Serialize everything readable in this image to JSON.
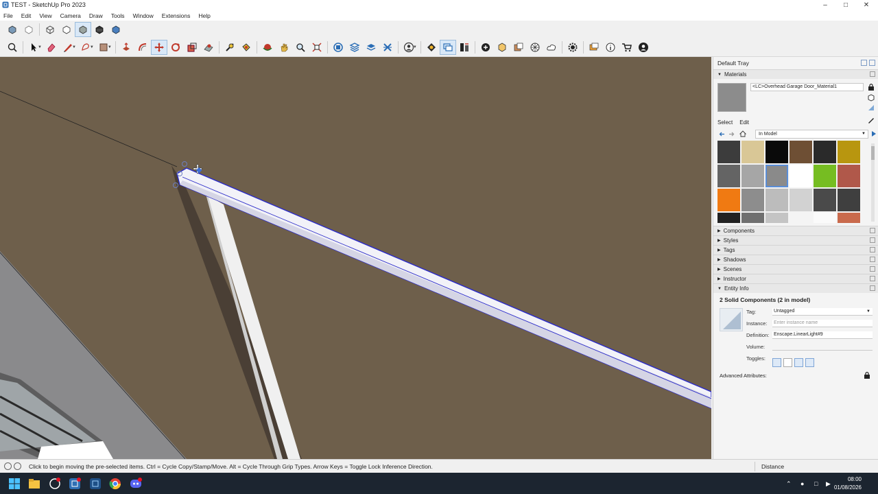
{
  "window": {
    "title": "TEST - SketchUp Pro 2023"
  },
  "menu": [
    "File",
    "Edit",
    "View",
    "Camera",
    "Draw",
    "Tools",
    "Window",
    "Extensions",
    "Help"
  ],
  "tray": {
    "title": "Default Tray",
    "materials": {
      "panel_label": "Materials",
      "current_name": "<LC>Overhead Garage Door_Material1",
      "tabs": [
        "Select",
        "Edit"
      ],
      "library": "In Model",
      "swatch_colors": [
        "#3c3c3c",
        "#d9c796",
        "#0a0a0a",
        "#6e4f34",
        "#2a2a2a",
        "#b8960f",
        "#646464",
        "#a6a6a6",
        "#8a8a8a",
        "#ffffff",
        "#76bd22",
        "#b0584a",
        "#f07a12",
        "#8d8d8d",
        "#bcbcbc",
        "#d2d2d2",
        "#4a4a4a",
        "#3f3f3f",
        "#222222",
        "#6f6f6f",
        "#c4c4c4",
        "#f4f4f4",
        "#fafafa",
        "#c96a4c"
      ],
      "selected_swatch": 8
    },
    "panels": [
      "Components",
      "Styles",
      "Tags",
      "Shadows",
      "Scenes",
      "Instructor",
      "Entity Info"
    ],
    "entity_info": {
      "title": "2 Solid Components (2 in model)",
      "tag_label": "Tag:",
      "tag_value": "Untagged",
      "instance_label": "Instance:",
      "instance_placeholder": "Enter instance name",
      "definition_label": "Definition:",
      "definition_value": "Enscape.LinearLight#9",
      "volume_label": "Volume:",
      "toggles_label": "Toggles:",
      "advanced_label": "Advanced Attributes:"
    }
  },
  "status": {
    "message": "Click to begin moving the pre-selected items.  Ctrl = Cycle Copy/Stamp/Move.  Alt = Cycle Through Grip Types.  Arrow Keys = Toggle Lock Inference Direction.",
    "measure_label": "Distance"
  },
  "taskbar": {
    "time": "08:00",
    "date": "01/08/2026"
  }
}
